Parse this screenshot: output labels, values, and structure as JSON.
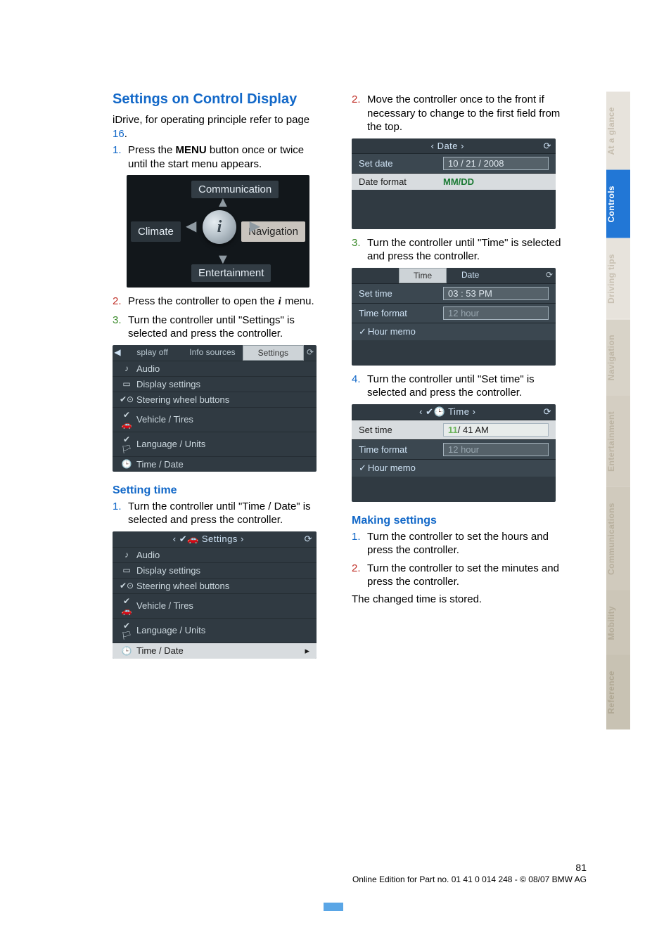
{
  "title": "Settings on Control Display",
  "intro_before": "iDrive, for operating principle refer to page ",
  "intro_link": "16",
  "intro_after": ".",
  "left_steps": {
    "s1a": "Press the ",
    "s1_menu": "MENU",
    "s1b": " button once or twice until the start menu appears.",
    "s2a": "Press the controller to open the ",
    "s2b": " menu.",
    "s3": "Turn the controller until \"Settings\" is selected and press the controller."
  },
  "startmenu": {
    "comm": "Communication",
    "ent": "Entertainment",
    "climate": "Climate",
    "nav": "Navigation"
  },
  "shot_settings_tabs": {
    "t1": "splay off",
    "t2": "Info sources",
    "t3": "Settings"
  },
  "settings_list": {
    "audio": "Audio",
    "display": "Display settings",
    "steering": "Steering wheel buttons",
    "vehicle": "Vehicle / Tires",
    "lang": "Language / Units",
    "time": "Time / Date"
  },
  "setting_time_head": "Setting time",
  "set_time_step1": "Turn the controller until \"Time / Date\" is selected and press the controller.",
  "settings_header": "Settings",
  "right_steps": {
    "s2": "Move the controller once to the front if necessary to change to the first field from the top.",
    "s3": "Turn the controller until \"Time\" is selected and press the controller.",
    "s4": "Turn the controller until \"Set time\" is selected and press the controller."
  },
  "date_shot": {
    "header": "Date",
    "set_date": "Set date",
    "date_val": "10 / 21 / 2008",
    "date_format": "Date format",
    "fmt_val": "MM/DD"
  },
  "time_shot": {
    "tab_time": "Time",
    "tab_date": "Date",
    "set_time": "Set time",
    "time_val": "03 : 53 PM",
    "time_format": "Time format",
    "fmt_val": "12 hour",
    "hour_memo": "Hour memo"
  },
  "time_shot2": {
    "header": "Time",
    "set_time": "Set time",
    "time_hl": "11",
    "time_rest": "/ 41 AM",
    "time_format": "Time format",
    "fmt_val": "12 hour",
    "hour_memo": "Hour memo"
  },
  "making_head": "Making settings",
  "making_s1": "Turn the controller to set the hours and press the controller.",
  "making_s2": "Turn the controller to set the minutes and press the controller.",
  "making_out": "The changed time is stored.",
  "sidetabs": {
    "glance": "At a glance",
    "controls": "Controls",
    "driving": "Driving tips",
    "nav": "Navigation",
    "ent": "Entertainment",
    "com": "Communications",
    "mob": "Mobility",
    "ref": "Reference"
  },
  "footer_page": "81",
  "footer_line": "Online Edition for Part no. 01 41 0 014 248 - © 08/07 BMW AG"
}
